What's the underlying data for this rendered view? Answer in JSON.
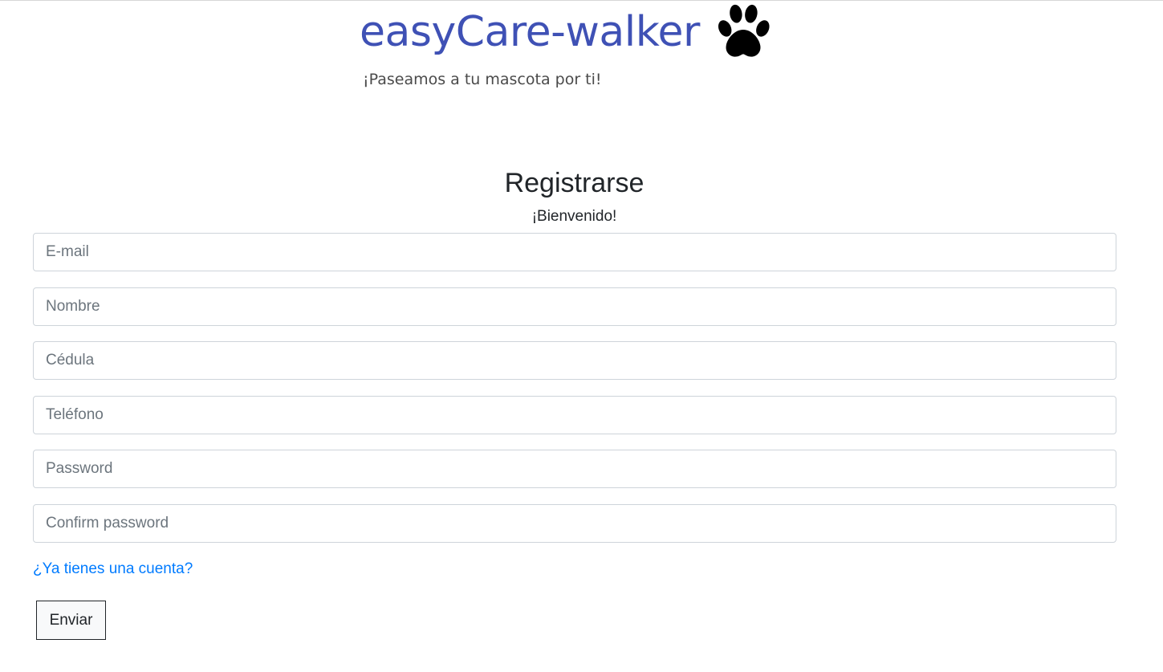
{
  "brand": {
    "name": "easyCare-walker",
    "tagline": "¡Paseamos a tu mascota por ti!",
    "logo_icon": "paw-icon"
  },
  "form": {
    "title": "Registrarse",
    "subtitle": "¡Bienvenido!",
    "fields": {
      "email": {
        "placeholder": "E-mail",
        "value": ""
      },
      "nombre": {
        "placeholder": "Nombre",
        "value": ""
      },
      "cedula": {
        "placeholder": "Cédula",
        "value": ""
      },
      "telefono": {
        "placeholder": "Teléfono",
        "value": ""
      },
      "password": {
        "placeholder": "Password",
        "value": ""
      },
      "confirm_password": {
        "placeholder": "Confirm password",
        "value": ""
      }
    },
    "login_link": "¿Ya tienes una cuenta?",
    "submit_label": "Enviar"
  },
  "colors": {
    "brand": "#3f51b5",
    "link": "#007bff",
    "input_border": "#ced4da"
  }
}
